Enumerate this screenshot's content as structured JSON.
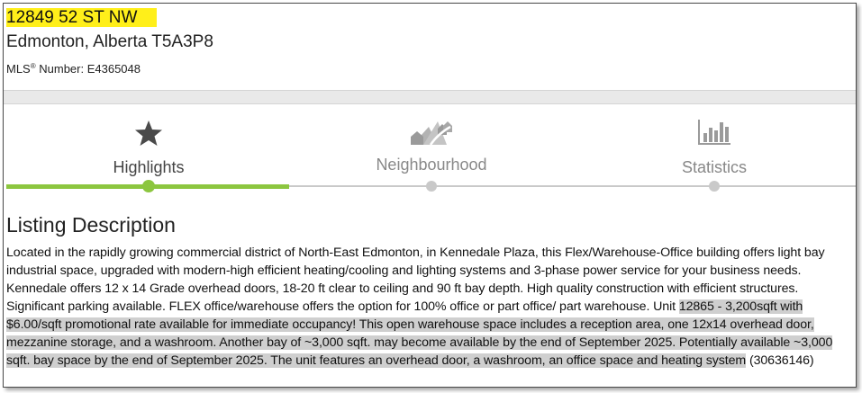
{
  "listing": {
    "address_line1": "12849 52 ST NW",
    "address_line2": "Edmonton, Alberta T5A3P8",
    "mls_label": "MLS",
    "mls_mark": "®",
    "mls_suffix": " Number: E4365048"
  },
  "tabs": [
    {
      "label": "Highlights",
      "icon": "star-icon",
      "active": true
    },
    {
      "label": "Neighbourhood",
      "icon": "neighbourhood-icon",
      "active": false
    },
    {
      "label": "Statistics",
      "icon": "bar-chart-icon",
      "active": false
    }
  ],
  "description": {
    "title": "Listing Description",
    "text_plain": "Located in the rapidly growing commercial district of North-East Edmonton, in Kennedale Plaza, this Flex/Warehouse-Office building offers light bay industrial space, upgraded with modern-high efficient heating/cooling and lighting systems and 3-phase power service for your business needs. Kennedale offers 12 x 14 Grade overhead doors, 18-20 ft clear to ceiling and 90 ft bay depth. High quality construction with efficient structures. Significant parking available. FLEX office/warehouse offers the option for 100% office or part office/ part warehouse. Unit ",
    "text_highlighted": "12865 - 3,200sqft with $6.00/sqft promotional rate available for immediate occupancy! This open warehouse space includes a reception area, one 12x14 overhead door, mezzanine storage, and a washroom. Another bay of ~3,000 sqft. may become available by the end of September 2025. Potentially available ~3,000 sqft. bay space by the end of September 2025. The unit features an overhead door, a washroom, an office space and heating system",
    "text_tail": " (30636146)"
  },
  "colors": {
    "address_highlight": "#ffef1a",
    "text_highlight": "#cfcfcf",
    "active_tab_accent": "#8cc63f",
    "inactive_track": "#c9c9c9"
  }
}
